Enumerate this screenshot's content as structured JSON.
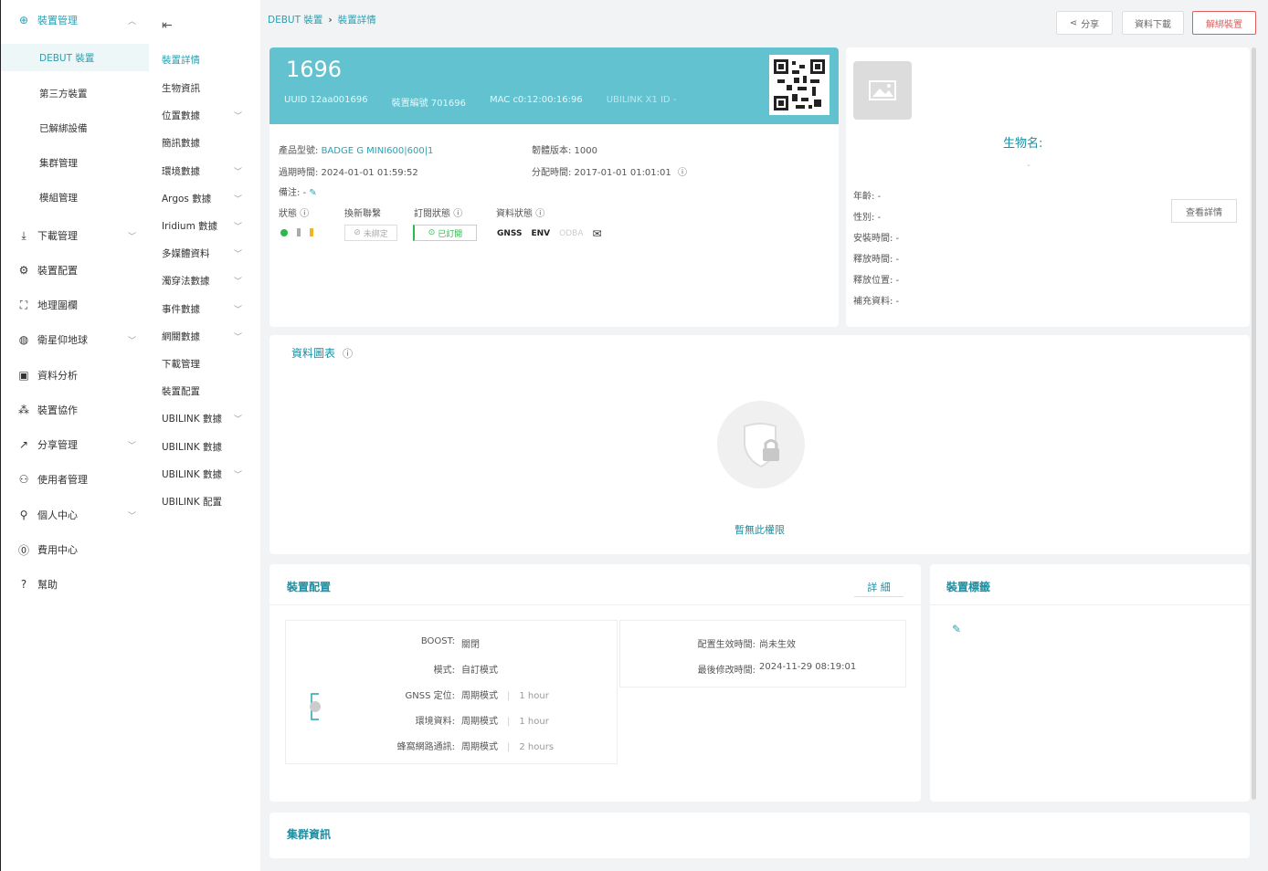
{
  "sidebar": {
    "items": [
      {
        "label": "裝置管理",
        "icon": "device-icon",
        "expanded": true
      },
      {
        "label": "DEBUT 裝置",
        "sub": true,
        "active": true
      },
      {
        "label": "第三方裝置",
        "sub": true
      },
      {
        "label": "已解綁設備",
        "sub": true
      },
      {
        "label": "集群管理",
        "sub": true
      },
      {
        "label": "模組管理",
        "sub": true
      },
      {
        "label": "下載管理",
        "icon": "download-icon",
        "chev": true
      },
      {
        "label": "裝置配置",
        "icon": "config-icon"
      },
      {
        "label": "地理圍欄",
        "icon": "geofence-icon"
      },
      {
        "label": "衛星仰地球",
        "icon": "globe-icon",
        "chev": true
      },
      {
        "label": "資料分析",
        "icon": "analysis-icon"
      },
      {
        "label": "裝置協作",
        "icon": "collab-icon"
      },
      {
        "label": "分享管理",
        "icon": "share-icon",
        "chev": true
      },
      {
        "label": "使用者管理",
        "icon": "users-icon"
      },
      {
        "label": "個人中心",
        "icon": "person-icon",
        "chev": true
      },
      {
        "label": "費用中心",
        "icon": "billing-icon"
      },
      {
        "label": "幫助",
        "icon": "help-icon"
      }
    ]
  },
  "submenu": {
    "items": [
      {
        "label": "裝置詳情",
        "active": true
      },
      {
        "label": "生物資訊"
      },
      {
        "label": "位置數據",
        "chev": true
      },
      {
        "label": "簡訊數據"
      },
      {
        "label": "環境數據",
        "chev": true
      },
      {
        "label": "Argos 數據",
        "chev": true
      },
      {
        "label": "Iridium 數據",
        "chev": true
      },
      {
        "label": "多媒體資料",
        "chev": true
      },
      {
        "label": "濁穿法數據",
        "chev": true
      },
      {
        "label": "事件數據",
        "chev": true
      },
      {
        "label": "網關數據",
        "chev": true
      },
      {
        "label": "下載管理"
      },
      {
        "label": "裝置配置"
      },
      {
        "label": "UBILINK 數據",
        "chev": true
      },
      {
        "label": "UBILINK 數據"
      },
      {
        "label": "UBILINK 數據",
        "chev": true
      },
      {
        "label": "UBILINK 配置"
      }
    ]
  },
  "header": {
    "breadcrumb": [
      "DEBUT 裝置",
      "裝置詳情"
    ],
    "share": "分享",
    "download": "資料下載",
    "unbind": "解綁裝置"
  },
  "device": {
    "id": "1696",
    "uuid": "UUID 12aa001696",
    "serial": "裝置編號 701696",
    "mac": "MAC c0:12:00:16:96",
    "ubilink": "UBILINK X1 ID -",
    "model_label": "產品型號:",
    "model": "BADGE G MINI600|600|1",
    "firmware": "韌體版本: 1000",
    "last_seen": "過期時間: 2024-01-01 01:59:52",
    "assigned": "分配時間: 2017-01-01 01:01:01",
    "note_label": "備注: -",
    "status_label": "狀態",
    "link_label": "換新聯繫",
    "sub_label": "訂閱狀態",
    "data_label": "資料狀態",
    "link_value": "未綁定",
    "sub_value": "已訂閱",
    "data_tags": [
      "GNSS",
      "ENV",
      "ODBA"
    ]
  },
  "animal": {
    "name_label": "生物名:",
    "name_value": "-",
    "age": "年齡: -",
    "sex": "性別: -",
    "install_time": "安裝時間: -",
    "release_time": "釋放時間: -",
    "release_place": "釋放位置: -",
    "extra": "補充資料: -",
    "view_detail": "查看詳情"
  },
  "chart": {
    "title": "資料圖表",
    "no_permission": "暫無此權限"
  },
  "config": {
    "title": "裝置配置",
    "detail_btn": "詳 細",
    "boost": "BOOST:",
    "boost_val": "關閉",
    "mode": "模式:",
    "mode_val": "自訂模式",
    "gnss": "GNSS 定位:",
    "gnss_mode": "周期模式",
    "gnss_val": "1 hour",
    "env": "環境資料:",
    "env_mode": "周期模式",
    "env_val": "1 hour",
    "cell": "蜂窩網路通訊:",
    "cell_mode": "周期模式",
    "cell_val": "2 hours",
    "effective": "配置生效時間:",
    "effective_val": "尚未生效",
    "last_modified": "最後修改時間:",
    "last_modified_val": "2024-11-29 08:19:01"
  },
  "tags": {
    "title": "裝置標籤"
  },
  "cluster": {
    "title": "集群資訊"
  },
  "colors": {
    "accent": "#2aa0b3",
    "header_teal": "#62c2cf",
    "danger": "#e25c5c"
  }
}
